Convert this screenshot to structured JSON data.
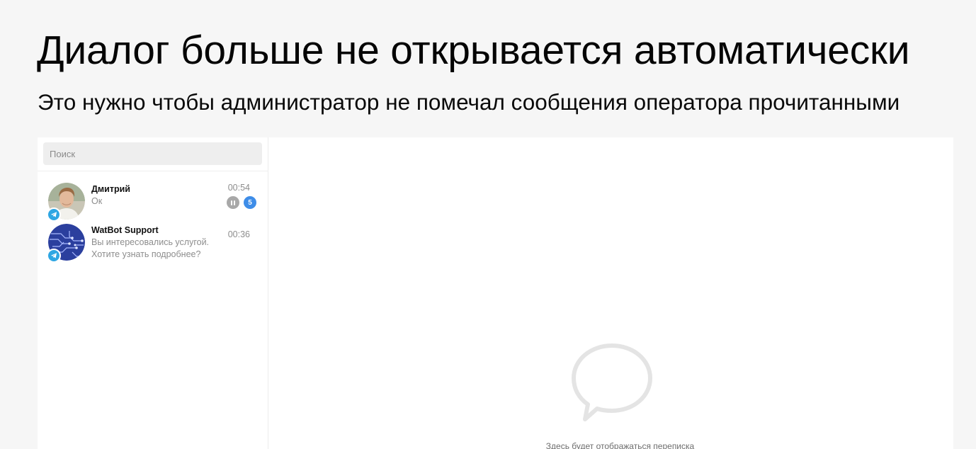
{
  "slide": {
    "title": "Диалог больше не открывается автоматически",
    "subtitle": "Это нужно чтобы администратор не помечал сообщения оператора прочитанными"
  },
  "search": {
    "placeholder": "Поиск",
    "value": ""
  },
  "chats": [
    {
      "name": "Дмитрий",
      "preview": "Ок",
      "time": "00:54",
      "unread": "5",
      "status_icon": "pause-icon",
      "channel_icon": "telegram-icon"
    },
    {
      "name": "WatBot Support",
      "preview_line1": "Вы интересовались услугой.",
      "preview_line2": "Хотите узнать подробнее?",
      "time": "00:36",
      "channel_icon": "telegram-icon"
    }
  ],
  "empty_state": {
    "icon": "chat-bubble-icon",
    "text": "Здесь будет отображаться переписка"
  },
  "colors": {
    "telegram": "#2ea6e3",
    "unread_badge": "#3e8de8",
    "pause_badge": "#a8a8a8"
  }
}
